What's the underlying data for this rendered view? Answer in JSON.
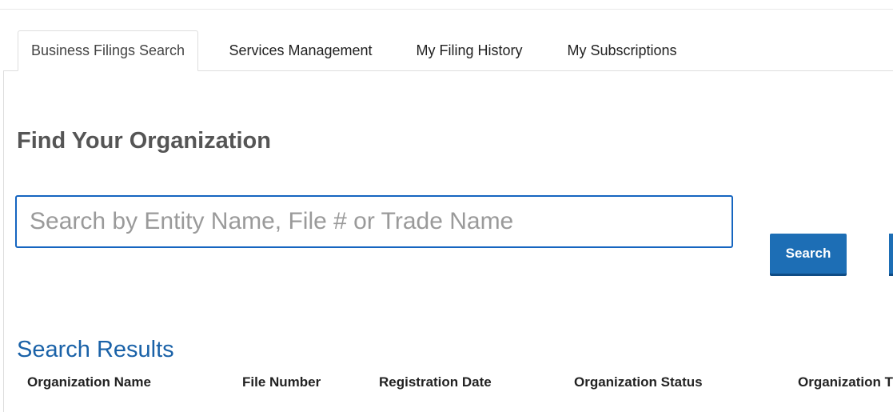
{
  "tabs": [
    {
      "label": "Business Filings Search",
      "active": true
    },
    {
      "label": "Services Management",
      "active": false
    },
    {
      "label": "My Filing History",
      "active": false
    },
    {
      "label": "My Subscriptions",
      "active": false
    }
  ],
  "main": {
    "title": "Find Your Organization",
    "search": {
      "placeholder": "Search by Entity Name, File # or Trade Name",
      "value": ""
    },
    "search_button_label": "Search"
  },
  "results": {
    "title": "Search Results",
    "columns": [
      "Organization Name",
      "File Number",
      "Registration Date",
      "Organization Status",
      "Organization T"
    ]
  },
  "colors": {
    "accent": "#1d6eb5",
    "input_border": "#1565c0",
    "results_title": "#1a62a8",
    "heading": "#555555"
  }
}
